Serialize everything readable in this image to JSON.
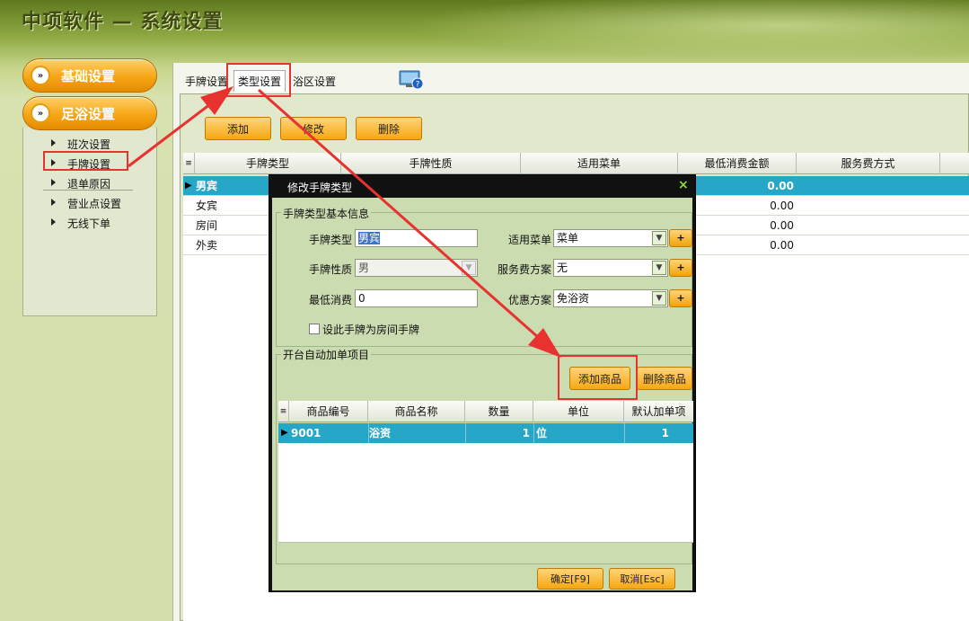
{
  "app": {
    "title": "中项软件 — 系统设置"
  },
  "sidebar": {
    "btn_basic": "基础设置",
    "btn_foot": "足浴设置",
    "circle_glyph": "»",
    "items": [
      "班次设置",
      "手牌设置",
      "退单原因",
      "营业点设置",
      "无线下单"
    ]
  },
  "tabs": [
    "手牌设置",
    "类型设置",
    "浴区设置"
  ],
  "toolbar": {
    "add": "添加",
    "edit": "修改",
    "delete": "删除"
  },
  "grid": {
    "headers": [
      "手牌类型",
      "手牌性质",
      "适用菜单",
      "最低消费金额",
      "服务费方式"
    ],
    "rows": [
      {
        "type": "男宾",
        "min": "0.00"
      },
      {
        "type": "女宾",
        "min": "0.00"
      },
      {
        "type": "房间",
        "min": "0.00"
      },
      {
        "type": "外卖",
        "min": "0.00"
      }
    ]
  },
  "dialog": {
    "title": "修改手牌类型",
    "close": "×",
    "group_basic": "手牌类型基本信息",
    "label_type": "手牌类型",
    "value_type": "男宾",
    "label_nature": "手牌性质",
    "value_nature": "男",
    "label_min": "最低消费",
    "value_min": "0",
    "label_menu": "适用菜单",
    "value_menu": "菜单",
    "label_service": "服务费方案",
    "value_service": "无",
    "label_discount": "优惠方案",
    "value_discount": "免浴资",
    "plus": "+",
    "checkbox_label": "设此手牌为房间手牌",
    "group_auto": "开台自动加单项目",
    "btn_add_item": "添加商品",
    "btn_del_item": "删除商品",
    "sub_headers": [
      "商品编号",
      "商品名称",
      "数量",
      "单位",
      "默认加单项"
    ],
    "sub_row": {
      "code": "9001",
      "name": "浴资",
      "qty": "1",
      "unit": "位",
      "default": "1"
    },
    "btn_ok": "确定[F9]",
    "btn_cancel": "取消[Esc]"
  },
  "colors": {
    "accent": "#f6a615",
    "selected_row": "#27a7c8",
    "annotation": "#e8322f"
  }
}
